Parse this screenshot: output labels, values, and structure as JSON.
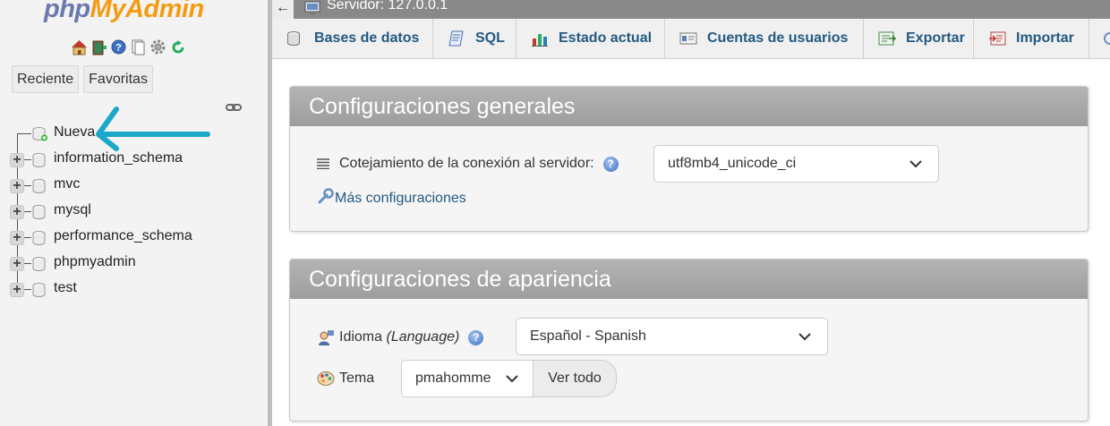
{
  "sidebar": {
    "logo": {
      "part1": "php",
      "part2": "MyAdmin"
    },
    "nav_icons": [
      "home-icon",
      "exit-icon",
      "help-icon",
      "docs-icon",
      "settings-icon",
      "reload-icon"
    ],
    "tabs": {
      "recent": "Reciente",
      "favorites": "Favoritas"
    },
    "tree": [
      {
        "label": "Nueva",
        "type": "new"
      },
      {
        "label": "information_schema",
        "type": "db"
      },
      {
        "label": "mvc",
        "type": "db"
      },
      {
        "label": "mysql",
        "type": "db"
      },
      {
        "label": "performance_schema",
        "type": "db"
      },
      {
        "label": "phpmyadmin",
        "type": "db"
      },
      {
        "label": "test",
        "type": "db"
      }
    ],
    "arrow_color": "#1aa7c9"
  },
  "topbar": {
    "back": "←",
    "server_label": "Servidor: 127.0.0.1"
  },
  "menu": {
    "tabs": [
      {
        "label": "Bases de datos",
        "icon": "database-icon"
      },
      {
        "label": "SQL",
        "icon": "sql-icon"
      },
      {
        "label": "Estado actual",
        "icon": "status-icon"
      },
      {
        "label": "Cuentas de usuarios",
        "icon": "users-icon"
      },
      {
        "label": "Exportar",
        "icon": "export-icon"
      },
      {
        "label": "Importar",
        "icon": "import-icon"
      }
    ]
  },
  "general": {
    "title": "Configuraciones generales",
    "collation_label": "Cotejamiento de la conexión al servidor:",
    "collation_value": "utf8mb4_unicode_ci",
    "more_settings": "Más configuraciones"
  },
  "appearance": {
    "title": "Configuraciones de apariencia",
    "language_label": "Idioma",
    "language_label_en": "(Language)",
    "language_value": "Español - Spanish",
    "theme_label": "Tema",
    "theme_value": "pmahomme",
    "view_all": "Ver todo"
  },
  "colors": {
    "link": "#235a81",
    "panel_header": "#a8a8a8",
    "topbar": "#898989",
    "logo_php": "#6c78af",
    "logo_myadmin": "#f39c12"
  }
}
